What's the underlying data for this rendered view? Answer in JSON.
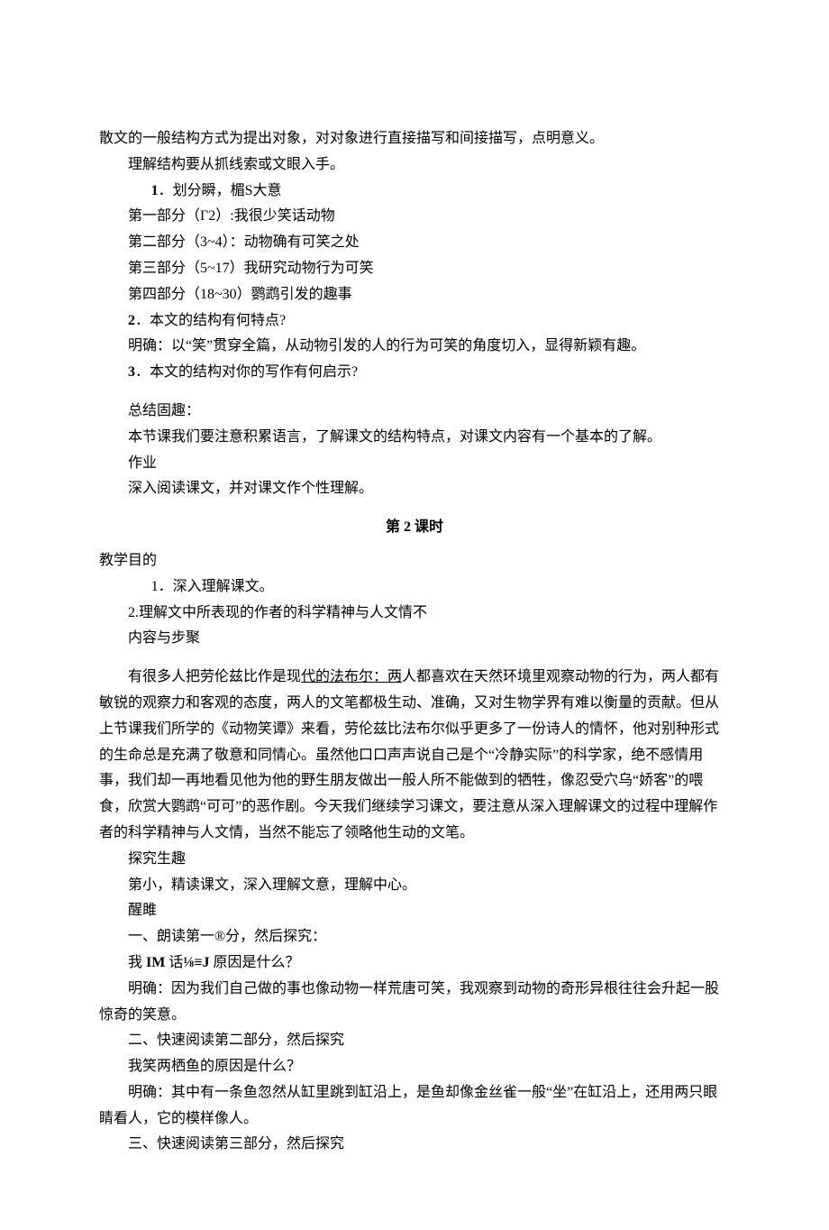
{
  "intro": "散文的一般结构方式为提出对象，对对象进行直接描写和间接描写，点明意义。",
  "line2": "理解结构要从抓线索或文眼入手。",
  "num1_prefix": "1",
  "num1_text": "．划分瞬，楣S大意",
  "parts": {
    "p1": "第一部分（Γ2）:我很少笑话动物",
    "p2": "第二部分（3~4）：动物确有可笑之处",
    "p3": "第三部分（5~17）我研究动物行为可笑",
    "p4": "第四部分（18~30）鹦鹉引发的趣事"
  },
  "num2_prefix": "2",
  "num2_text": "．本文的结构有何特点?",
  "ans2": "明确：以“笑”贯穿全篇，从动物引发的人的行为可笑的角度切入，显得新颖有趣。",
  "num3_prefix": "3",
  "num3_text": "．本文的结构对你的写作有何启示?",
  "summary_h": "总结固趣：",
  "summary_body": "本节课我们要注意积累语言，了解课文的结构特点，对课文内容有一个基本的了解。",
  "hw_h": "作业",
  "hw_body": "深入阅读课文，并对课文作个性理解。",
  "lesson2_title": "第 2 课时",
  "aim_h": "教学目的",
  "aim1_prefix": "1",
  "aim1_text": "．深入理解课文。",
  "aim2": "2.理解文中所表现的作者的科学精神与人文情不",
  "steps_h": "内容与步聚",
  "big_para_pre": "有很多人把劳伦兹比作是现",
  "big_para_ul": "代的法布尔：两",
  "big_para_post": "人都喜欢在天然环境里观察动物的行为，两人都有敏锐的观察力和客观的态度，两人的文笔都极生动、准确，又对生物学界有难以衡量的贡献。但从上节课我们所学的《动物笑谭》来看，劳伦兹比法布尔似乎更多了一份诗人的情怀，他对别种形式的生命总是充满了敬意和同情心。虽然他口口声声说自己是个“冷静实际”的科学家，绝不感情用事，我们却一再地看见他为他的野生朋友做出一般人所不能做到的牺牲，像忍受穴乌“娇客”的喂食，欣赏大鹦鹉“可可”的恶作剧。今天我们继续学习课文，要注意从深入理解课文的过程中理解作者的科学精神与人文情，当然不能忘了领略他生动的文笔。",
  "explore_h": "探究生趣",
  "explore_sub": "第小，精读课文，深入理解文意，理解中心。",
  "xing_h": "醒雎",
  "sec1_h": "一、朗读第一®分，然后探究：",
  "sec1_q_pre": "我 ",
  "sec1_q_b1": "IM",
  "sec1_q_mid": " 话",
  "sec1_q_b2": "⅛≡J",
  "sec1_q_post": " 原因是什么？",
  "sec1_a": "明确：因为我们自己做的事也像动物一样荒唐可笑，我观察到动物的奇形异根往往会升起一股惊奇的笑意。",
  "sec2_h": "二、快速阅读第二部分，然后探究",
  "sec2_q": "我笑两栖鱼的原因是什么？",
  "sec2_a": "明确：其中有一条鱼忽然从缸里跳到缸沿上，是鱼却像金丝雀一般“坐”在缸沿上，还用两只眼睛看人，它的模样像人。",
  "sec3_h": "三、快速阅读第三部分，然后探究"
}
